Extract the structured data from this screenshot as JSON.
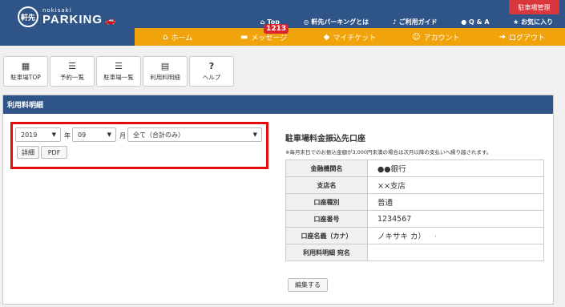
{
  "header": {
    "logo_mark": "軒先",
    "logo_small": "nokisaki",
    "logo_big": "PARKING",
    "admin_label": "駐車場管理",
    "topnav": [
      {
        "icon": "home-icon",
        "glyph": "⌂",
        "label": "Top"
      },
      {
        "icon": "logo-icon",
        "glyph": "◎",
        "label": "軒先パーキングとは"
      },
      {
        "icon": "guide-icon",
        "glyph": "♪",
        "label": "ご利用ガイド"
      },
      {
        "icon": "question-icon",
        "glyph": "●",
        "label": "Q & A"
      },
      {
        "icon": "star-icon",
        "glyph": "★",
        "label": "お気に入り"
      }
    ],
    "orange_items": [
      {
        "icon": "home-icon",
        "glyph": "⌂",
        "label": "ホーム"
      },
      {
        "icon": "message-icon",
        "glyph": "▬",
        "label": "メッセージ",
        "badge": "1213"
      },
      {
        "icon": "ticket-icon",
        "glyph": "◆",
        "label": "マイチケット"
      },
      {
        "icon": "account-icon",
        "glyph": "☺",
        "label": "アカウント"
      },
      {
        "icon": "logout-icon",
        "glyph": "➜",
        "label": "ログアウト"
      }
    ],
    "colors": {
      "header_bg": "#2e5488",
      "orange": "#f0a30a",
      "admin": "#d9363e"
    }
  },
  "toolbar": [
    {
      "icon": "grid-icon",
      "glyph": "▦",
      "label": "駐車場TOP"
    },
    {
      "icon": "list-icon",
      "glyph": "☰",
      "label": "予約一覧"
    },
    {
      "icon": "list-icon",
      "glyph": "☰",
      "label": "駐車場一覧"
    },
    {
      "icon": "document-icon",
      "glyph": "▤",
      "label": "利用料明細"
    },
    {
      "icon": "help-icon",
      "glyph": "?",
      "label": "ヘルプ"
    }
  ],
  "panel": {
    "title": "利用料明細",
    "filters": {
      "year": "2019",
      "year_unit": "年",
      "month": "09",
      "month_unit": "月",
      "lot": "全て（合計のみ）",
      "detail_label": "詳細",
      "pdf_label": "PDF"
    },
    "bank": {
      "title": "駐車場料金振込先口座",
      "note": "※毎月末日でのお振込金額が3,000円未満の場合は次月以降の支払いへ繰り越されます。",
      "rows": [
        {
          "label": "金融機関名",
          "value": "●●銀行"
        },
        {
          "label": "支店名",
          "value": "××支店"
        },
        {
          "label": "口座種別",
          "value": "普通"
        },
        {
          "label": "口座番号",
          "value": "1234567"
        },
        {
          "label": "口座名義（カナ）",
          "value": "ノキサキ カ）"
        },
        {
          "label": "利用料明細 宛名",
          "value": ""
        }
      ],
      "tick": "ꜝ",
      "edit_label": "編集する"
    }
  }
}
